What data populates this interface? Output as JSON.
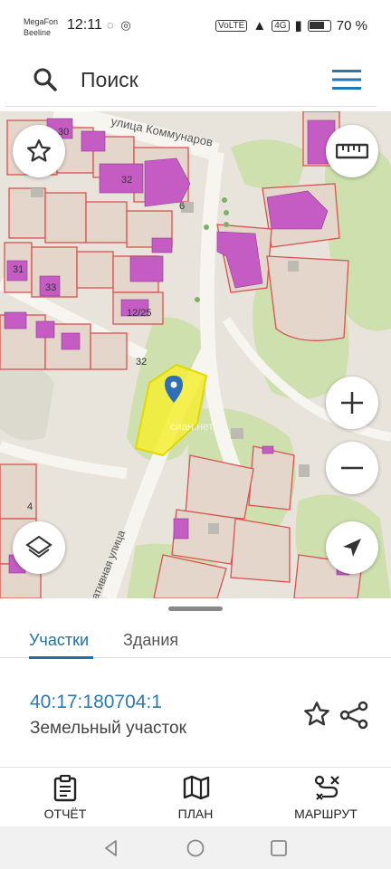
{
  "status_bar": {
    "carrier_1": "MegaFon",
    "carrier_2": "Beeline",
    "time": "12:11",
    "network": "4G",
    "wifi_label": "VoLTE",
    "battery": "70 %"
  },
  "search": {
    "placeholder": "Поиск"
  },
  "map": {
    "street_1": "улица Коммунаров",
    "street_2": "ативная улица",
    "house_labels": [
      "30",
      "32",
      "6",
      "31",
      "33",
      "12/25",
      "32",
      "4"
    ],
    "watermark": "сиан.нет",
    "colors": {
      "building": "#c45cc4",
      "parcel_line": "#d9534f",
      "green": "#c9dfa8",
      "selected": "#f2ee2a"
    }
  },
  "sheet": {
    "tab_parcels": "Участки",
    "tab_buildings": "Здания",
    "parcel_id": "40:17:180704:1",
    "parcel_type": "Земельный участок"
  },
  "actions": {
    "report": "ОТЧЁТ",
    "plan": "ПЛАН",
    "route": "МАРШРУТ"
  }
}
